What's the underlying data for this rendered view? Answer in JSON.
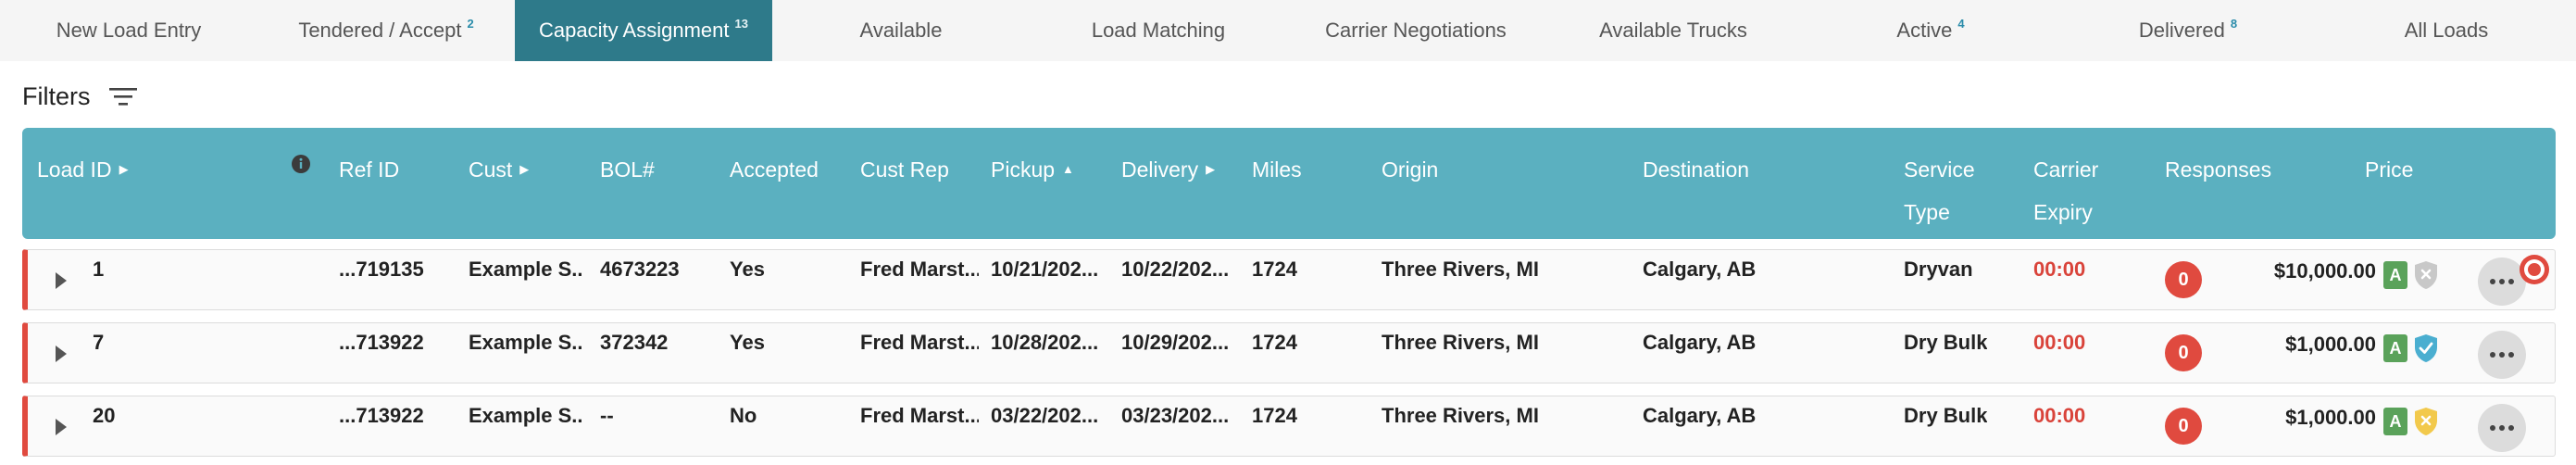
{
  "tabs": [
    {
      "label": "New Load Entry",
      "badge": ""
    },
    {
      "label": "Tendered / Accept",
      "badge": "2"
    },
    {
      "label": "Capacity Assignment",
      "badge": "13"
    },
    {
      "label": "Available",
      "badge": ""
    },
    {
      "label": "Load Matching",
      "badge": ""
    },
    {
      "label": "Carrier Negotiations",
      "badge": ""
    },
    {
      "label": "Available Trucks",
      "badge": ""
    },
    {
      "label": "Active",
      "badge": "4"
    },
    {
      "label": "Delivered",
      "badge": "8"
    },
    {
      "label": "All Loads",
      "badge": ""
    }
  ],
  "filters": {
    "label": "Filters"
  },
  "columns": {
    "load_id": "Load ID",
    "ref_id": "Ref ID",
    "cust": "Cust",
    "bol": "BOL#",
    "accepted": "Accepted",
    "cust_rep": "Cust Rep",
    "pickup": "Pickup",
    "delivery": "Delivery",
    "miles": "Miles",
    "origin": "Origin",
    "destination": "Destination",
    "service_type_1": "Service",
    "service_type_2": "Type",
    "carrier_expiry_1": "Carrier",
    "carrier_expiry_2": "Expiry",
    "responses": "Responses",
    "price": "Price"
  },
  "rows": [
    {
      "load_id": "1",
      "ref_id": "...719135",
      "cust": "Example S...",
      "bol": "4673223",
      "accepted": "Yes",
      "cust_rep": "Fred Marst...",
      "pickup": "10/21/202...",
      "delivery": "10/22/202...",
      "miles": "1724",
      "origin": "Three Rivers, MI",
      "destination": "Calgary, AB",
      "service_type": "Dryvan",
      "carrier_expiry": "00:00",
      "responses": "0",
      "price": "$10,000.00",
      "badge": "A"
    },
    {
      "load_id": "7",
      "ref_id": "...713922",
      "cust": "Example S...",
      "bol": "372342",
      "accepted": "Yes",
      "cust_rep": "Fred Marst...",
      "pickup": "10/28/202...",
      "delivery": "10/29/202...",
      "miles": "1724",
      "origin": "Three Rivers, MI",
      "destination": "Calgary, AB",
      "service_type": "Dry Bulk",
      "carrier_expiry": "00:00",
      "responses": "0",
      "price": "$1,000.00",
      "badge": "A"
    },
    {
      "load_id": "20",
      "ref_id": "...713922",
      "cust": "Example S...",
      "bol": "--",
      "accepted": "No",
      "cust_rep": "Fred Marst...",
      "pickup": "03/22/202...",
      "delivery": "03/23/202...",
      "miles": "1724",
      "origin": "Three Rivers, MI",
      "destination": "Calgary, AB",
      "service_type": "Dry Bulk",
      "carrier_expiry": "00:00",
      "responses": "0",
      "price": "$1,000.00",
      "badge": "A"
    }
  ],
  "icons": {
    "filter": "filter-lines-icon",
    "info": "info-icon",
    "expand": "caret-right-icon",
    "more": "more-horizontal-icon",
    "shield_gray": "shield-x-icon",
    "shield_check": "shield-check-icon",
    "shield_warn": "shield-x-icon",
    "record": "record-icon"
  },
  "colors": {
    "active_tab": "#2e7a8a",
    "header": "#5bb0c0",
    "row_accent": "#e04a3f",
    "expiry": "#d9433a",
    "accepted_badge": "#5aa25a",
    "shield_gray": "#c8c8c8",
    "shield_check": "#4aaed0",
    "shield_warn": "#f2c94c"
  }
}
